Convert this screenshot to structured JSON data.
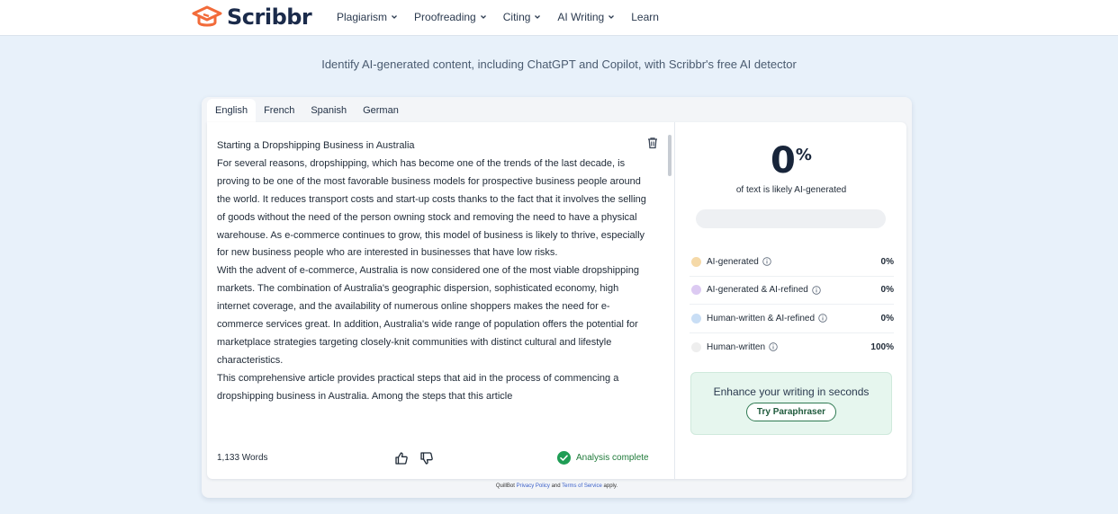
{
  "header": {
    "brand": "Scribbr",
    "nav": [
      {
        "label": "Plagiarism",
        "has_menu": true
      },
      {
        "label": "Proofreading",
        "has_menu": true
      },
      {
        "label": "Citing",
        "has_menu": true
      },
      {
        "label": "AI Writing",
        "has_menu": true
      },
      {
        "label": "Learn",
        "has_menu": false
      }
    ]
  },
  "tagline": "Identify AI-generated content, including ChatGPT and Copilot, with Scribbr's free AI detector",
  "tabs": [
    "English",
    "French",
    "Spanish",
    "German"
  ],
  "active_tab": "English",
  "editor": {
    "paragraphs": [
      "Starting a Dropshipping Business in Australia",
      "For several reasons, dropshipping, which has become one of the trends of the last decade, is proving to be one of the most favorable business models for prospective business people around the world. It reduces transport costs and start-up costs thanks to the fact that it involves the selling of goods without the need of the person owning stock and removing the need to have a physical warehouse. As e-commerce continues to grow, this model of business is likely to thrive, especially for new business people who are interested in businesses that have low risks.",
      "With the advent of e-commerce, Australia is now considered one of the most viable dropshipping markets. The combination of Australia's geographic dispersion, sophisticated economy, high internet coverage, and the availability of numerous online shoppers makes the need for e-commerce services great. In addition, Australia's wide range of population offers the potential for marketplace strategies targeting closely-knit communities with distinct cultural and lifestyle characteristics.",
      "This comprehensive article provides practical steps that aid in the process of commencing a dropshipping business in Australia. Among the steps that this article"
    ],
    "word_count": "1,133 Words",
    "status": "Analysis complete"
  },
  "result": {
    "percent_value": "0",
    "percent_sign": "%",
    "percent_label": "of text is likely AI-generated",
    "bar_fraction": 0,
    "legend": [
      {
        "label": "AI-generated",
        "value": "0%",
        "color": "#f5d9a8"
      },
      {
        "label": "AI-generated & AI-refined",
        "value": "0%",
        "color": "#dccaf2"
      },
      {
        "label": "Human-written & AI-refined",
        "value": "0%",
        "color": "#c9def5"
      },
      {
        "label": "Human-written",
        "value": "100%",
        "color": "#eeeeee"
      }
    ],
    "promo_text": "Enhance your writing in seconds",
    "promo_button": "Try Paraphraser"
  },
  "footer": {
    "prefix": "QuillBot ",
    "privacy": "Privacy Policy",
    "and": " and ",
    "terms": "Terms of Service",
    "suffix": " apply."
  },
  "colors": {
    "page_bg": "#e8f1fa",
    "success": "#1f9d55",
    "brand_orange": "#f26b3a",
    "brand_navy": "#1b2b4b"
  }
}
